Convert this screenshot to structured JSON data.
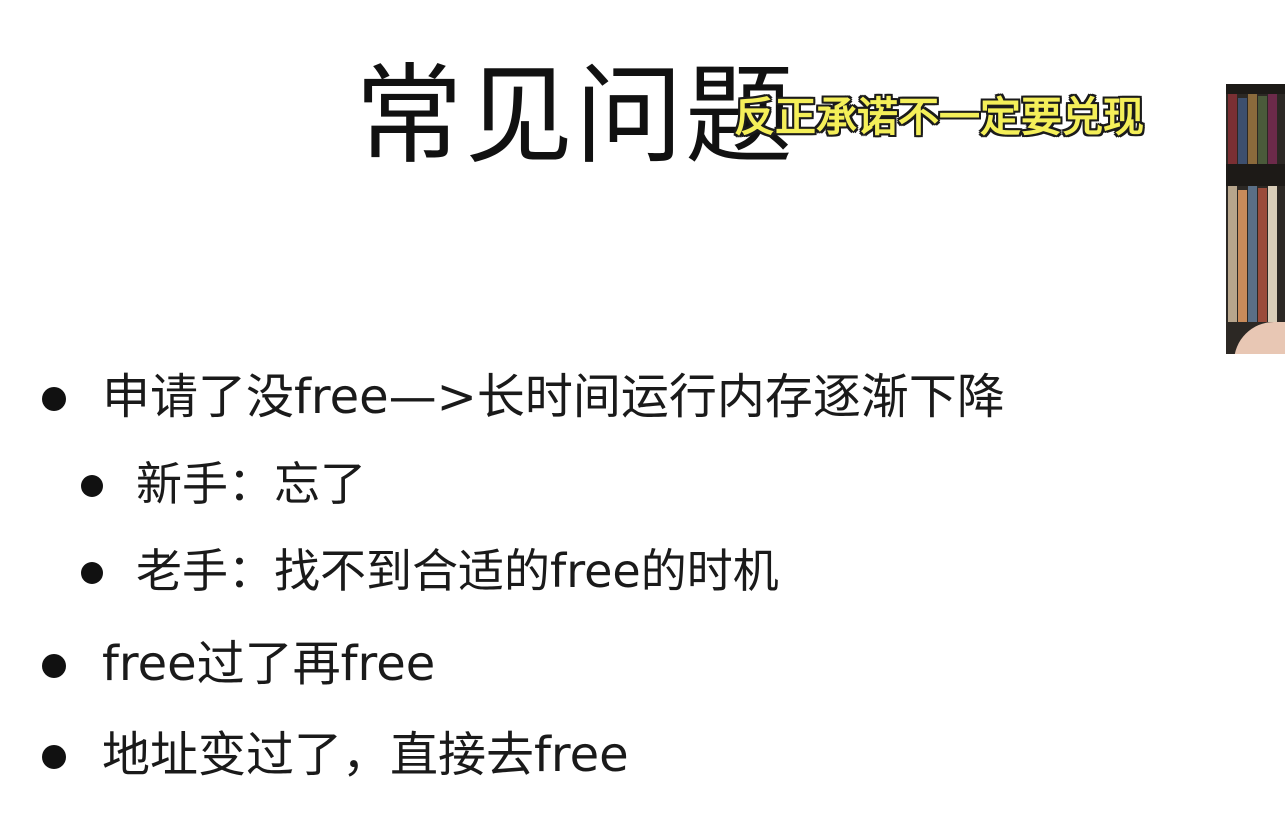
{
  "slide": {
    "title": "常见问题",
    "caption": "反正承诺不一定要兑现",
    "bullets": [
      {
        "level": 1,
        "text": "申请了没free—>长时间运行内存逐渐下降"
      },
      {
        "level": 2,
        "text": "新手：忘了"
      },
      {
        "level": 2,
        "text": "老手：找不到合适的free的时机"
      },
      {
        "level": 1,
        "text": "free过了再free"
      },
      {
        "level": 1,
        "text": "地址变过了，直接去free"
      }
    ]
  },
  "colors": {
    "caption_fill": "#f4ef59",
    "caption_outline": "#1b1b1b",
    "text": "#1a1a1a"
  },
  "icons": {
    "bullet": "bullet-dot-icon"
  }
}
